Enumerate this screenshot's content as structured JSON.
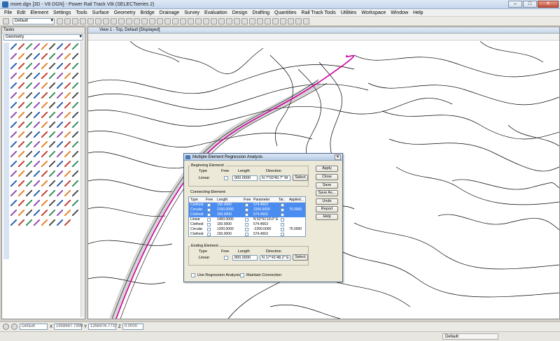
{
  "window": {
    "title": "more.dgn [3D - V8 DGN] - Power Rail Track V8i (SELECTseries 2)",
    "min": "–",
    "max": "□",
    "close": "✕"
  },
  "menu": [
    "File",
    "Edit",
    "Element",
    "Settings",
    "Tools",
    "Surface",
    "Geometry",
    "Bridge",
    "Drainage",
    "Survey",
    "Evaluation",
    "Design",
    "Drafting",
    "Quantities",
    "Rail Track Tools",
    "Utilities",
    "Workspace",
    "Window",
    "Help"
  ],
  "toolbar": {
    "level": "Default"
  },
  "tasks": {
    "header": "Tasks",
    "category": "Geometry"
  },
  "view": {
    "title": "View 1 - Top, Default [Displayed]"
  },
  "status": {
    "level": "Default",
    "x_value": "1958667.7999",
    "y_value": "1356976.7737",
    "z_value": "0.0000",
    "x_label": "X",
    "y_label": "Y",
    "z_label": "Z",
    "model": "Default"
  },
  "dialog": {
    "title": "Multiple Element Regression Analysis",
    "close": "✕",
    "beginning": {
      "label": "Beginning Element:",
      "type_header": "Type",
      "free_header": "Free",
      "length_header": "Length",
      "direction_header": "Direction",
      "type": "Linear",
      "length": "900.0000",
      "direction": "N 7°02'40.7\" W",
      "select": "Select"
    },
    "connecting": {
      "label": "Connecting Element:",
      "headers": [
        "Type",
        "Free",
        "Length",
        "Free",
        "Parameter",
        "Tar..",
        "Applied..."
      ],
      "rows": [
        {
          "type": "Clothoid",
          "length": "150.0000",
          "parameter": "574.4563",
          "applied": "",
          "selected": true
        },
        {
          "type": "Circular",
          "length": "2150.0000",
          "parameter": "2200.0000",
          "applied": "75.0000",
          "selected": true
        },
        {
          "type": "Clothoid",
          "length": "150.0000",
          "parameter": "574.4563",
          "applied": "",
          "selected": true
        },
        {
          "type": "Linear",
          "length": "1450.0000",
          "parameter": "N 52°51'19.0\" E",
          "applied": "",
          "selected": false
        },
        {
          "type": "Clothoid",
          "length": "150.0000",
          "parameter": "574.4563",
          "applied": "",
          "selected": false
        },
        {
          "type": "Circular",
          "length": "1200.0000",
          "parameter": "-2200.0000",
          "applied": "75.0000",
          "selected": false
        },
        {
          "type": "Clothoid",
          "length": "150.0000",
          "parameter": "574.4563",
          "applied": "",
          "selected": false
        }
      ]
    },
    "ending": {
      "label": "Ending Element",
      "type_header": "Type",
      "free_header": "Free",
      "length_header": "Length",
      "direction_header": "Direction",
      "type": "Linear",
      "length": "800.0000",
      "direction": "N 17°41'48.2\" E",
      "select": "Select"
    },
    "buttons": [
      "Apply",
      "Close",
      "Save",
      "Save As...",
      "Undo",
      "Report",
      "Help"
    ],
    "options": {
      "use_regression": "Use Regression Analysis",
      "maintain_connection": "Maintain Connection"
    }
  },
  "colors": {
    "alignment": "#d000a0",
    "selection": "#4b8cf0",
    "contour": "#000000"
  }
}
